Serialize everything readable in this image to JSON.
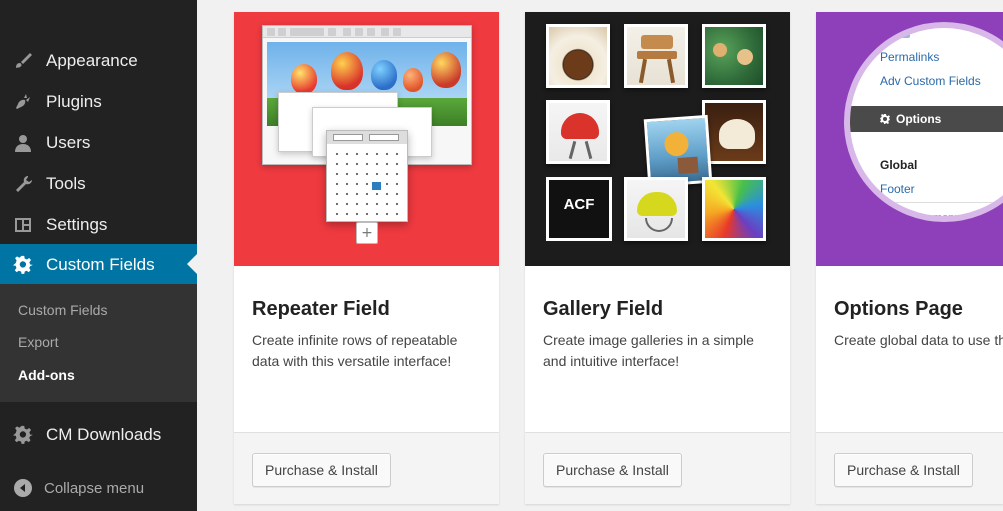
{
  "colors": {
    "sidebar_bg": "#222222",
    "submenu_bg": "#333333",
    "active_bg": "#0074a2",
    "repeater_bg": "#ef3a40",
    "gallery_bg": "#1c1c1c",
    "options_bg": "#8e3fba"
  },
  "sidebar": {
    "items": [
      {
        "label": "Appearance",
        "icon": "paintbrush-icon"
      },
      {
        "label": "Plugins",
        "icon": "plug-icon"
      },
      {
        "label": "Users",
        "icon": "user-icon"
      },
      {
        "label": "Tools",
        "icon": "wrench-icon"
      },
      {
        "label": "Settings",
        "icon": "settings-grid-icon"
      },
      {
        "label": "Custom Fields",
        "icon": "gear-icon",
        "active": true
      }
    ],
    "submenu": [
      {
        "label": "Custom Fields"
      },
      {
        "label": "Export"
      },
      {
        "label": "Add-ons",
        "current": true
      }
    ],
    "extra_item": {
      "label": "CM Downloads",
      "icon": "gear-icon"
    },
    "collapse_label": "Collapse menu"
  },
  "cards": [
    {
      "title": "Repeater Field",
      "description": "Create infinite rows of repeatable data with this versatile interface!",
      "button": "Purchase & Install"
    },
    {
      "title": "Gallery Field",
      "description": "Create image galleries in a simple and intuitive interface!",
      "button": "Purchase & Install",
      "logo_text": "ACF"
    },
    {
      "title": "Options Page",
      "description": "Create global data to use throughout your website",
      "button": "Purchase & Install",
      "menu_preview": {
        "items": [
          "Permalinks",
          "Adv Custom Fields"
        ],
        "highlight": "Options",
        "sub_items": [
          "Global",
          "Footer"
        ],
        "collapse": "Collapse menu"
      }
    }
  ]
}
